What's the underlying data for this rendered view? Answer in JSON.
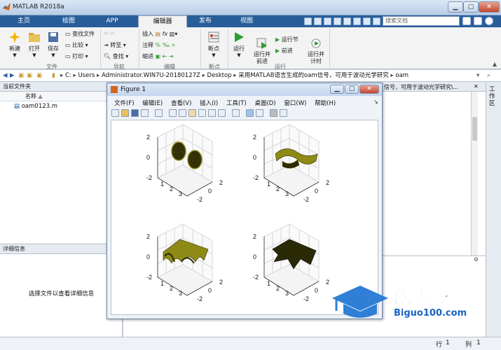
{
  "app": {
    "title": "MATLAB R2018a"
  },
  "tabs": [
    {
      "label": "主页"
    },
    {
      "label": "绘图"
    },
    {
      "label": "APP"
    },
    {
      "label": "编辑器"
    },
    {
      "label": "发布"
    },
    {
      "label": "视图"
    }
  ],
  "search": {
    "placeholder": "搜索文档"
  },
  "ribbon": {
    "file": {
      "new": "新建",
      "open": "打开",
      "save": "保存",
      "find_files": "查找文件",
      "compare": "比较",
      "print": "打印",
      "group": "文件"
    },
    "nav": {
      "goto": "转至",
      "find": "查找",
      "group": "导航"
    },
    "edit": {
      "insert": "插入",
      "comment": "注释",
      "indent": "缩进",
      "group": "编辑"
    },
    "breakpoints": {
      "label": "断点",
      "group": "断点"
    },
    "run": {
      "run": "运行",
      "run_advance": "运行并\n前进",
      "run_section": "运行节",
      "advance": "前进",
      "run_time": "运行并\n计时",
      "group": "运行"
    }
  },
  "path": {
    "segments": [
      "C:",
      "Users",
      "Administrator.WIN7U-20180127Z",
      "Desktop",
      "采用MATLAB语言生成的oam信号，可用于波动光学研究",
      "oam"
    ]
  },
  "current_folder": {
    "title": "当前文件夹",
    "col_name": "名称",
    "file": "oam0123.m"
  },
  "details": {
    "title": "详细信息",
    "empty_msg": "选择文件以查看详细信息"
  },
  "editor_tab_text": "信号，可用于波动光学研究\\...",
  "workspace_side_label": "工作区",
  "figure": {
    "title": "Figure 1",
    "menu": [
      "文件(F)",
      "编辑(E)",
      "查看(V)",
      "插入(I)",
      "工具(T)",
      "桌面(D)",
      "窗口(W)",
      "帮助(H)"
    ],
    "axes": {
      "y_ticks": [
        "2",
        "0",
        "-2"
      ],
      "x_ticks": [
        "1",
        "2",
        "3"
      ],
      "side_ticks": [
        "2",
        "0",
        "-2"
      ]
    }
  },
  "status": {
    "row_label": "行",
    "row": "1",
    "col_label": "列",
    "col": "1"
  },
  "watermark": {
    "cn": "必过源码",
    "url": "Biguo100.com"
  },
  "colors": {
    "tab_bar": "#275e9a",
    "surface": "#8f8a16",
    "surface_dark": "#2b2a06"
  }
}
